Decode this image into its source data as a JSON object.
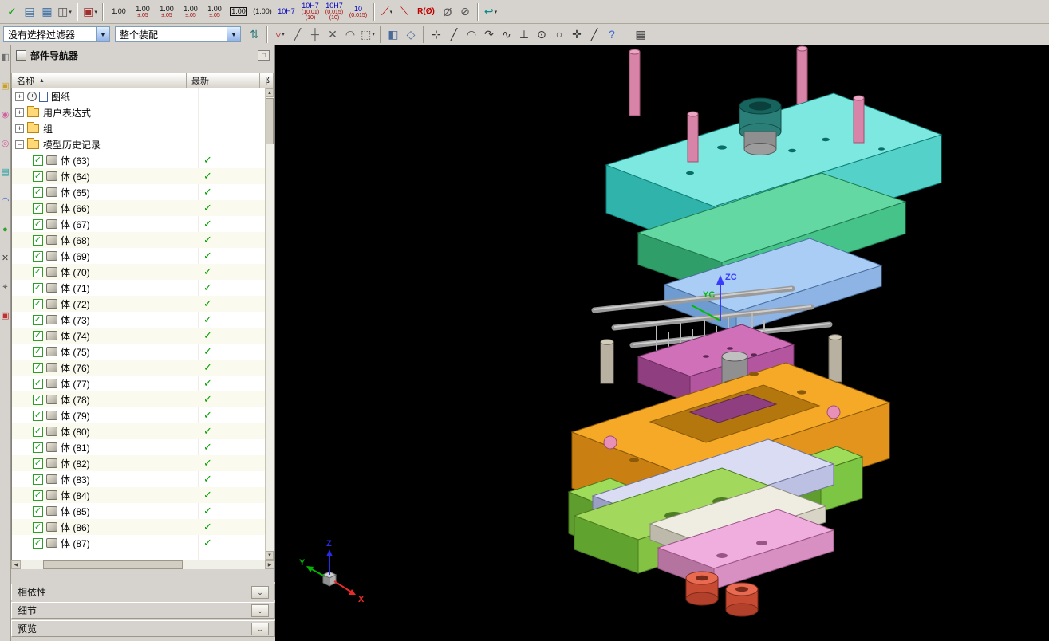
{
  "top_toolbar": {
    "icons_a": [
      {
        "name": "finish-sketch-icon",
        "glyph": "✓",
        "color": "#00a000"
      },
      {
        "name": "sheet-edit-icon",
        "glyph": "▤",
        "color": "#3a6ea5"
      },
      {
        "name": "table-icon",
        "glyph": "▦",
        "color": "#3a6ea5"
      },
      {
        "name": "view-style-icon",
        "glyph": "◫",
        "color": "#555",
        "dd": true
      }
    ],
    "icons_b": [
      {
        "name": "stamp-icon",
        "glyph": "▣",
        "color": "#a03030",
        "dd": true
      }
    ],
    "dim_buttons": [
      {
        "main": "1.00",
        "sub": "",
        "sub2": ""
      },
      {
        "main": "1.00",
        "sub": "±.05",
        "sub2": ""
      },
      {
        "main": "1.00",
        "sub": "±.05",
        "sub2": ""
      },
      {
        "main": "1.00",
        "sub": "±.05",
        "sub2": ""
      },
      {
        "main": "1.00",
        "sub": "±.05",
        "sub2": ""
      },
      {
        "main": "1.00",
        "sub": "",
        "sub2": "",
        "boxed": true
      },
      {
        "main": "(1.00)",
        "sub": "",
        "sub2": ""
      },
      {
        "main": "10H7",
        "sub": "",
        "sub2": "",
        "color": "#0000bb"
      },
      {
        "main": "10H7",
        "sub": "(10.01)",
        "sub2": "(10)",
        "color": "#0000bb"
      },
      {
        "main": "10H7",
        "sub": "(0.015)",
        "sub2": "(10)",
        "color": "#0000bb"
      },
      {
        "main": "10",
        "sub": "(0.015)",
        "sub2": "",
        "color": "#0000bb"
      }
    ],
    "icons_c": [
      {
        "name": "slant-dimension-icon",
        "glyph": "⟋",
        "color": "#c00000",
        "dd": true
      },
      {
        "name": "slant-dimension-2-icon",
        "glyph": "⟍",
        "color": "#c00000"
      },
      {
        "name": "radius-diameter-label-icon",
        "glyph": "R(Ø)",
        "color": "#c00000",
        "cls": "wide"
      },
      {
        "name": "diameter-icon",
        "glyph": "Ø",
        "color": "#555"
      },
      {
        "name": "no-diameter-icon",
        "glyph": "⊘",
        "color": "#555"
      }
    ],
    "icons_d": [
      {
        "name": "undo-icon",
        "glyph": "↩",
        "color": "#0a8a8a",
        "dd": true
      }
    ]
  },
  "toolbar2": {
    "filter_value": "没有选择过滤器",
    "scope_value": "整个装配",
    "icons_a": [
      {
        "name": "reorder-icon",
        "glyph": "⇅",
        "color": "#2a7a7a"
      }
    ],
    "snap_icons": [
      {
        "name": "snap-point-icon",
        "glyph": "▿",
        "color": "#b03030",
        "dd": true
      },
      {
        "name": "snap-endpoint-icon",
        "glyph": "╱",
        "color": "#555"
      },
      {
        "name": "snap-midpoint-icon",
        "glyph": "┼",
        "color": "#555"
      },
      {
        "name": "snap-intersection-icon",
        "glyph": "✕",
        "color": "#555"
      },
      {
        "name": "snap-arc-center-icon",
        "glyph": "◠",
        "color": "#555"
      }
    ],
    "select_icons": [
      {
        "name": "marquee-select-icon",
        "glyph": "⬚",
        "color": "#555",
        "dd": true
      }
    ],
    "view_icons": [
      {
        "name": "shaded-view-icon",
        "glyph": "◧",
        "color": "#4a6a9a"
      },
      {
        "name": "wireframe-view-icon",
        "glyph": "◇",
        "color": "#4a6a9a"
      }
    ],
    "geom_icons": [
      {
        "name": "point-dialog-icon",
        "glyph": "⊹",
        "color": "#333"
      },
      {
        "name": "line-icon",
        "glyph": "╱",
        "color": "#333"
      },
      {
        "name": "arc-icon",
        "glyph": "◠",
        "color": "#333"
      },
      {
        "name": "curve-icon",
        "glyph": "↷",
        "color": "#333"
      },
      {
        "name": "spline-icon",
        "glyph": "∿",
        "color": "#333"
      },
      {
        "name": "perpendicular-icon",
        "glyph": "⊥",
        "color": "#333"
      },
      {
        "name": "point-on-curve-icon",
        "glyph": "⊙",
        "color": "#333"
      },
      {
        "name": "circle-icon",
        "glyph": "○",
        "color": "#333"
      },
      {
        "name": "cross-icon",
        "glyph": "✛",
        "color": "#333"
      },
      {
        "name": "slash-icon",
        "glyph": "╱",
        "color": "#333"
      },
      {
        "name": "help-icon",
        "glyph": "?",
        "color": "#3a6ad0"
      }
    ],
    "grid_icon": {
      "glyph": "▦"
    }
  },
  "left_strip": {
    "icons": [
      {
        "name": "docked-view-icon",
        "glyph": "◧",
        "color": "#707070"
      },
      {
        "name": "docked-sketch-icon",
        "glyph": "▣",
        "color": "#caa020"
      },
      {
        "name": "docked-magenta-icon",
        "glyph": "◉",
        "color": "#d060a0"
      },
      {
        "name": "docked-ring-icon",
        "glyph": "◎",
        "color": "#d060a0"
      },
      {
        "name": "docked-teal-icon",
        "glyph": "▤",
        "color": "#20a0a0"
      },
      {
        "name": "docked-arc-icon",
        "glyph": "◠",
        "color": "#2060d0"
      },
      {
        "name": "docked-sphere-icon",
        "glyph": "●",
        "color": "#30a030"
      },
      {
        "name": "docked-cross-icon",
        "glyph": "✕",
        "color": "#404040"
      },
      {
        "name": "docked-target-icon",
        "glyph": "⌖",
        "color": "#404040"
      },
      {
        "name": "docked-red-icon",
        "glyph": "▣",
        "color": "#c03030"
      }
    ]
  },
  "navigator": {
    "title": "部件导航器",
    "col_name": "名称",
    "sort_glyph": "▲",
    "col_status": "最新",
    "col_extra": "阝",
    "expand_plus": "+",
    "expand_minus": "−",
    "check_glyph": "✓",
    "groups": [
      {
        "label": "图纸"
      },
      {
        "label": "用户表达式"
      },
      {
        "label": "组"
      },
      {
        "label": "模型历史记录"
      }
    ],
    "bodies": [
      "体 (63)",
      "体 (64)",
      "体 (65)",
      "体 (66)",
      "体 (67)",
      "体 (68)",
      "体 (69)",
      "体 (70)",
      "体 (71)",
      "体 (72)",
      "体 (73)",
      "体 (74)",
      "体 (75)",
      "体 (76)",
      "体 (77)",
      "体 (78)",
      "体 (79)",
      "体 (80)",
      "体 (81)",
      "体 (82)",
      "体 (83)",
      "体 (84)",
      "体 (85)",
      "体 (86)",
      "体 (87)"
    ]
  },
  "panels": [
    "相依性",
    "细节",
    "预览"
  ],
  "panels_chevron": "⌄",
  "viewport": {
    "wcs": {
      "zc": "ZC",
      "yc": "YC"
    },
    "triad": {
      "x": "X",
      "y": "Y",
      "z": "Z"
    }
  }
}
